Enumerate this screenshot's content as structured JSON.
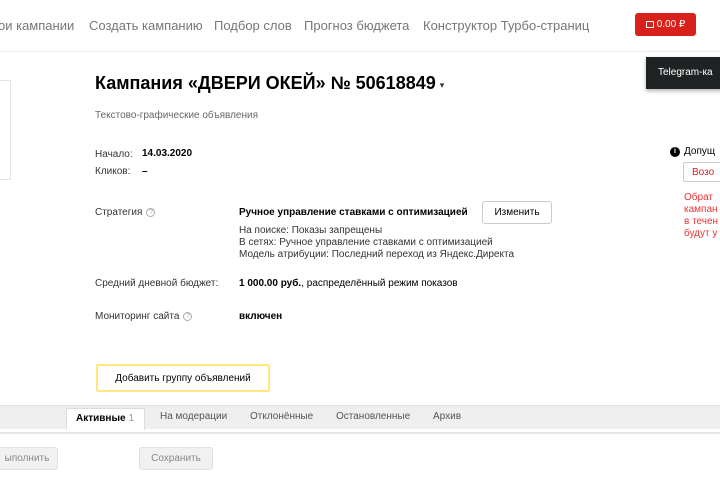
{
  "topnav": {
    "items": [
      "ои кампании",
      "Создать кампанию",
      "Подбор слов",
      "Прогноз бюджета",
      "Конструктор Турбо-страниц"
    ],
    "balance": "0.00 ₽"
  },
  "tooltip": "Telegram-ка",
  "campaign": {
    "title": "Кампания «ДВЕРИ ОКЕЙ» № 50618849",
    "title_arrow": "▾",
    "type": "Текстово-графические объявления"
  },
  "stats": {
    "start_label": "Начало:",
    "start_value": "14.03.2020",
    "clicks_label": "Кликов:",
    "clicks_value": "–"
  },
  "strategy": {
    "label": "Стратегия",
    "value": "Ручное управление ставками с оптимизацией",
    "change_label": "Изменить",
    "details": [
      "На поиске: Показы запрещены",
      "В сетях: Ручное управление ставками с оптимизацией",
      "Модель атрибуции: Последний переход из Яндекс.Директа"
    ]
  },
  "budget": {
    "label": "Средний дневной бюджет:",
    "value": "1 000.00 руб.",
    "suffix": ", распределённый режим показов"
  },
  "monitoring": {
    "label": "Мониторинг сайта",
    "value": "включен"
  },
  "add_group_label": "Добавить группу объявлений",
  "right_panel": {
    "info": "Допущ",
    "box": "Возо",
    "errors": [
      "Обрат",
      "кампан",
      "в течен",
      "будут у"
    ]
  },
  "tabs": {
    "active": "Активные",
    "active_count": "1",
    "items": [
      "На модерации",
      "Отклонённые",
      "Остановленные",
      "Архив"
    ]
  },
  "bottom": {
    "left_button": "ыполнить",
    "save_button": "Сохранить"
  },
  "colors": {
    "accent_red": "#d9211c",
    "highlight_yellow": "#ffe680"
  }
}
